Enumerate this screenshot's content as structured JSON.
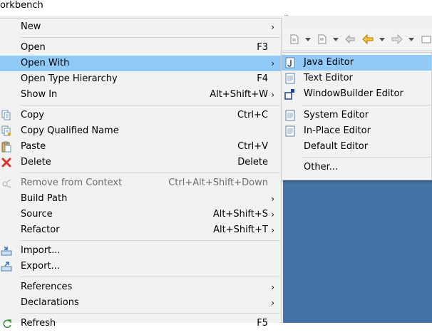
{
  "window": {
    "title": "orkbench",
    "title_fragment": "p"
  },
  "menu": {
    "items": [
      {
        "label": "New",
        "shortcut": "",
        "arrow": true
      },
      {
        "label": "Open",
        "shortcut": "F3",
        "arrow": false
      },
      {
        "label": "Open With",
        "shortcut": "",
        "arrow": true
      },
      {
        "label": "Open Type Hierarchy",
        "shortcut": "F4",
        "arrow": false
      },
      {
        "label": "Show In",
        "shortcut": "Alt+Shift+W",
        "arrow": true
      },
      {
        "label": "Copy",
        "shortcut": "Ctrl+C",
        "arrow": false
      },
      {
        "label": "Copy Qualified Name",
        "shortcut": "",
        "arrow": false
      },
      {
        "label": "Paste",
        "shortcut": "Ctrl+V",
        "arrow": false
      },
      {
        "label": "Delete",
        "shortcut": "Delete",
        "arrow": false
      },
      {
        "label": "Remove from Context",
        "shortcut": "Ctrl+Alt+Shift+Down",
        "arrow": false
      },
      {
        "label": "Build Path",
        "shortcut": "",
        "arrow": true
      },
      {
        "label": "Source",
        "shortcut": "Alt+Shift+S",
        "arrow": true
      },
      {
        "label": "Refactor",
        "shortcut": "Alt+Shift+T",
        "arrow": true
      },
      {
        "label": "Import...",
        "shortcut": "",
        "arrow": false
      },
      {
        "label": "Export...",
        "shortcut": "",
        "arrow": false
      },
      {
        "label": "References",
        "shortcut": "",
        "arrow": true
      },
      {
        "label": "Declarations",
        "shortcut": "",
        "arrow": true
      },
      {
        "label": "Refresh",
        "shortcut": "F5",
        "arrow": false
      }
    ],
    "arrow_glyph": "›"
  },
  "submenu": {
    "items": [
      {
        "label": "Java Editor"
      },
      {
        "label": "Text Editor"
      },
      {
        "label": "WindowBuilder Editor"
      },
      {
        "label": "System Editor"
      },
      {
        "label": "In-Place Editor"
      },
      {
        "label": "Default Editor"
      },
      {
        "label": "Other..."
      }
    ]
  },
  "colors": {
    "highlight": "#91c9f7",
    "menu_bg": "#f2f2f2",
    "editor_bg": "#4472a4",
    "disabled_text": "#6d6d6d",
    "nav_yellow": "#e8a200"
  }
}
